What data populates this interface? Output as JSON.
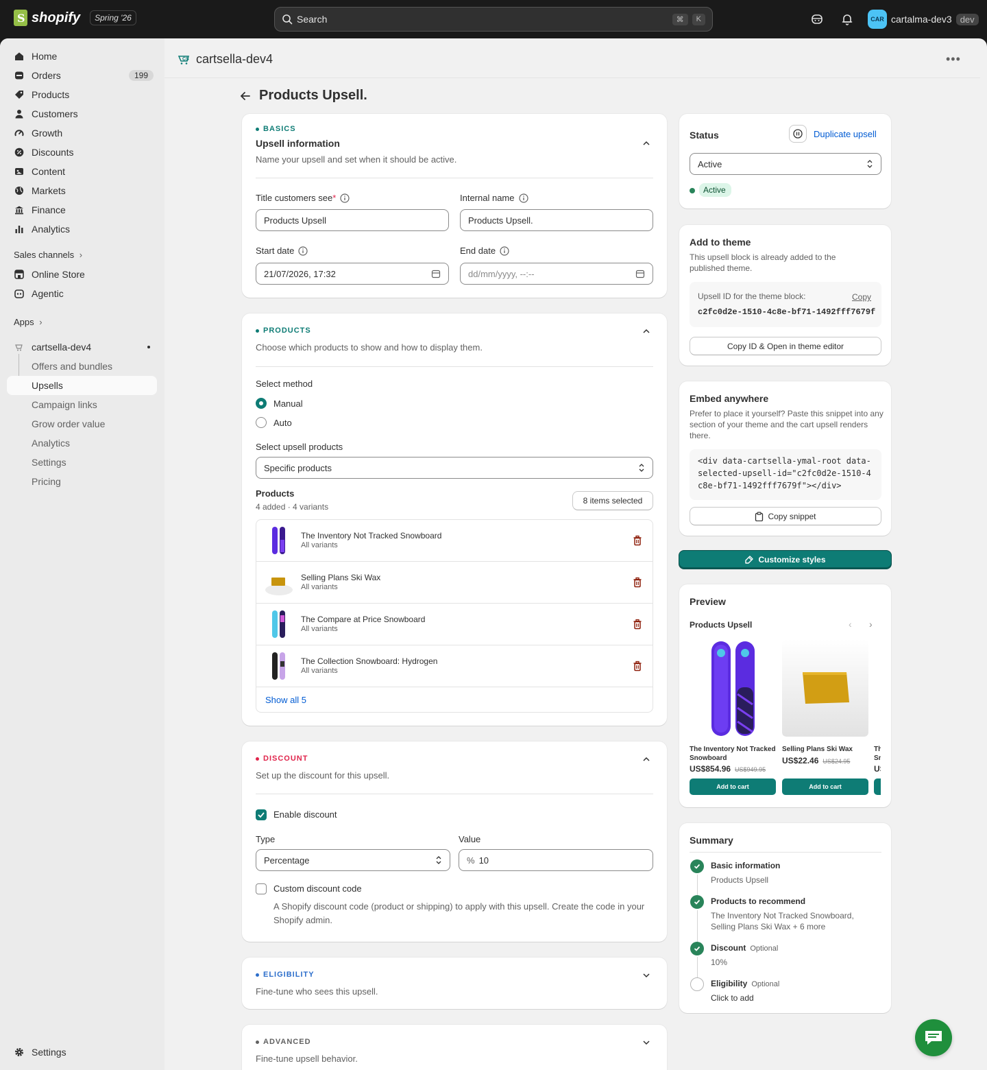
{
  "topbar": {
    "logo_text": "shopify",
    "season": "Spring '26",
    "search_placeholder": "Search",
    "kbd": [
      "⌘",
      "K"
    ],
    "avatar_initials": "CAR",
    "account_name": "cartalma-dev3",
    "account_tag": "dev"
  },
  "sidebar": {
    "items": [
      {
        "label": "Home",
        "icon": "home-icon"
      },
      {
        "label": "Orders",
        "icon": "orders-icon",
        "badge": "199"
      },
      {
        "label": "Products",
        "icon": "tag-icon"
      },
      {
        "label": "Customers",
        "icon": "person-icon"
      },
      {
        "label": "Growth",
        "icon": "gauge-icon"
      },
      {
        "label": "Discounts",
        "icon": "discount-icon"
      },
      {
        "label": "Content",
        "icon": "content-icon"
      },
      {
        "label": "Markets",
        "icon": "globe-icon"
      },
      {
        "label": "Finance",
        "icon": "bank-icon"
      },
      {
        "label": "Analytics",
        "icon": "bar-chart-icon"
      }
    ],
    "sales_channels_label": "Sales channels",
    "channels": [
      {
        "label": "Online Store",
        "icon": "store-icon"
      },
      {
        "label": "Agentic",
        "icon": "robot-icon"
      }
    ],
    "apps_label": "Apps",
    "app_name": "cartsella-dev4",
    "app_subitems": [
      "Offers and bundles",
      "Upsells",
      "Campaign links",
      "Grow order value",
      "Analytics",
      "Settings",
      "Pricing"
    ],
    "settings_label": "Settings"
  },
  "app_header": {
    "title": "cartsella-dev4"
  },
  "page": {
    "title": "Products Upsell."
  },
  "basics": {
    "tag": "BASICS",
    "title": "Upsell information",
    "desc": "Name your upsell and set when it should be active.",
    "title_label": "Title customers see",
    "title_required": "*",
    "title_value": "Products Upsell",
    "internal_label": "Internal name",
    "internal_value": "Products Upsell.",
    "start_label": "Start date",
    "start_value": "21/07/2026, 17:32",
    "end_label": "End date",
    "end_placeholder": "dd/mm/yyyy, --:--"
  },
  "products": {
    "tag": "PRODUCTS",
    "desc": "Choose which products to show and how to display them.",
    "method_label": "Select method",
    "method_manual": "Manual",
    "method_auto": "Auto",
    "select_label": "Select upsell products",
    "select_value": "Specific products",
    "list_title": "Products",
    "list_meta": "4 added · 4 variants",
    "selected_button": "8 items selected",
    "items": [
      {
        "name": "The Inventory Not Tracked Snowboard",
        "variants": "All variants"
      },
      {
        "name": "Selling Plans Ski Wax",
        "variants": "All variants"
      },
      {
        "name": "The Compare at Price Snowboard",
        "variants": "All variants"
      },
      {
        "name": "The Collection Snowboard: Hydrogen",
        "variants": "All variants"
      }
    ],
    "show_all": "Show all 5"
  },
  "discount": {
    "tag": "DISCOUNT",
    "desc": "Set up the discount for this upsell.",
    "enable_label": "Enable discount",
    "type_label": "Type",
    "type_value": "Percentage",
    "value_label": "Value",
    "value_prefix": "%",
    "value": "10",
    "custom_label": "Custom discount code",
    "custom_desc": "A Shopify discount code (product or shipping) to apply with this upsell. Create the code in your Shopify admin."
  },
  "eligibility": {
    "tag": "ELIGIBILITY",
    "desc": "Fine-tune who sees this upsell."
  },
  "advanced": {
    "tag": "ADVANCED",
    "desc": "Fine-tune upsell behavior."
  },
  "status": {
    "title": "Status",
    "duplicate": "Duplicate upsell",
    "select_value": "Active",
    "badge": "Active"
  },
  "theme": {
    "title": "Add to theme",
    "desc": "This upsell block is already added to the published theme.",
    "id_label": "Upsell ID for the theme block:",
    "copy": "Copy",
    "id_value": "c2fc0d2e-1510-4c8e-bf71-1492fff7679f",
    "button": "Copy ID & Open in theme editor"
  },
  "embed": {
    "title": "Embed anywhere",
    "desc": "Prefer to place it yourself? Paste this snippet into any section of your theme and the cart upsell renders there.",
    "code": "<div data-cartsella-ymal-root data-selected-upsell-id=\"c2fc0d2e-1510-4c8e-bf71-1492fff7679f\"></div>",
    "button": "Copy snippet"
  },
  "customize_button": "Customize styles",
  "preview": {
    "title": "Preview",
    "widget_title": "Products Upsell",
    "items": [
      {
        "name": "The Inventory Not Tracked Snowboard",
        "price": "US$854.96",
        "compare": "US$949.95",
        "button": "Add to cart"
      },
      {
        "name": "Selling Plans Ski Wax",
        "price": "US$22.46",
        "compare": "US$24.95",
        "button": "Add to cart"
      },
      {
        "name": "Th Sn",
        "price": "US",
        "compare": "",
        "button": ""
      }
    ]
  },
  "summary": {
    "title": "Summary",
    "steps": [
      {
        "title": "Basic information",
        "optional": "",
        "desc": "Products Upsell",
        "done": true
      },
      {
        "title": "Products to recommend",
        "optional": "",
        "desc": "The Inventory Not Tracked Snowboard, Selling Plans Ski Wax + 6 more",
        "done": true
      },
      {
        "title": "Discount",
        "optional": "Optional",
        "desc": "10%",
        "done": true
      },
      {
        "title": "Eligibility",
        "optional": "Optional",
        "desc": "Click to add",
        "done": false
      }
    ]
  },
  "colors": {
    "accent": "#0e7c75",
    "success": "#29845a",
    "link": "#005bd3",
    "discount_tag": "#e0244b",
    "eligibility_tag": "#2c6ecb"
  }
}
